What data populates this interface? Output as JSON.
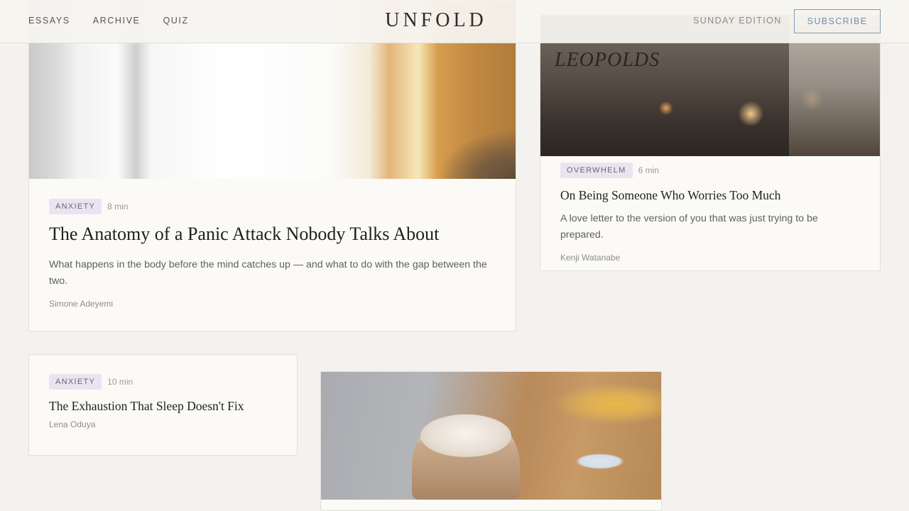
{
  "header": {
    "nav": [
      "ESSAYS",
      "ARCHIVE",
      "QUIZ"
    ],
    "brand": "UNFOLD",
    "edition": "SUNDAY EDITION",
    "subscribe": "SUBSCRIBE"
  },
  "articles": [
    {
      "tag": "ANXIETY",
      "read_time": "8 min",
      "title": "The Anatomy of a Panic Attack Nobody Talks About",
      "excerpt": "What happens in the body before the mind catches up — and what to do with the gap between the two.",
      "author": "Simone Adeyemi"
    },
    {
      "tag": "OVERWHELM",
      "read_time": "6 min",
      "title": "On Being Someone Who Worries Too Much",
      "excerpt": "A love letter to the version of you that was just trying to be prepared.",
      "author": "Kenji Watanabe",
      "image_sign": "LEOPOLDS"
    },
    {
      "tag": "ANXIETY",
      "read_time": "10 min",
      "title": "The Exhaustion That Sleep Doesn't Fix",
      "author": "Lena Oduya"
    }
  ]
}
